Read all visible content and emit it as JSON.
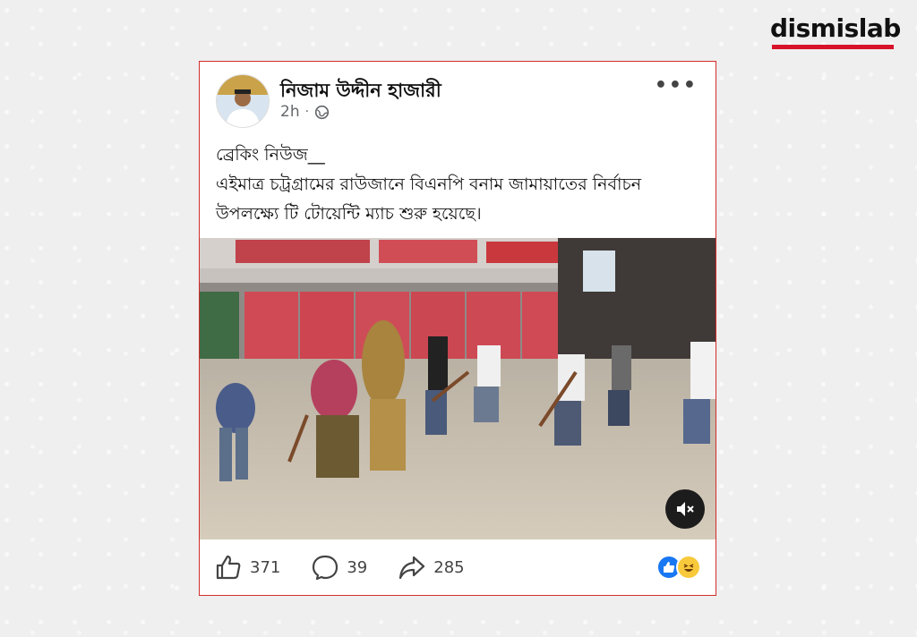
{
  "brand": {
    "name": "dismislab",
    "accent": "#d7132a"
  },
  "post": {
    "author": "নিজাম উদ্দীন হাজারী",
    "time": "2h",
    "visibility_icon": "globe-icon",
    "more_icon": "more-icon",
    "caption_lines": [
      "ব্রেকিং নিউজ__",
      "এইমাত্র চট্রগ্রামের রাউজানে বিএনপি বনাম জামায়াতের নির্বাচন",
      "উপলক্ষ্যে টি টোয়েন্টি ম্যাচ শুরু হয়েছে।"
    ]
  },
  "stats": {
    "likes": "371",
    "comments": "39",
    "shares": "285"
  },
  "reactions": [
    "like-reaction-icon",
    "haha-reaction-icon"
  ]
}
